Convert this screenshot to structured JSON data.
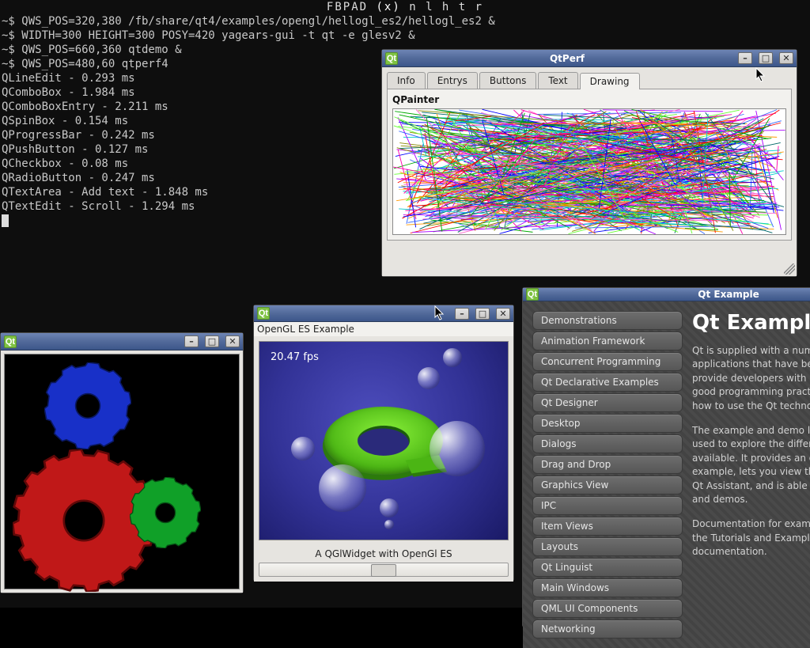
{
  "terminal": {
    "fbpad_prefix": "FBPAD ",
    "fbpad_sel": "(x)",
    "fbpad_rest": " n  l  h  t  r",
    "lines": [
      "~$ QWS_POS=320,380 /fb/share/qt4/examples/opengl/hellogl_es2/hellogl_es2 &",
      "~$ WIDTH=300 HEIGHT=300 POSY=420 yagears-gui -t qt -e glesv2 &",
      "~$ QWS_POS=660,360 qtdemo &",
      "~$ QWS_POS=480,60 qtperf4",
      "QLineEdit - 0.293 ms",
      "QComboBox - 1.984 ms",
      "QComboBoxEntry - 2.211 ms",
      "QSpinBox - 0.154 ms",
      "QProgressBar - 0.242 ms",
      "QPushButton - 0.127 ms",
      "QCheckbox - 0.08 ms",
      "QRadioButton - 0.247 ms",
      "QTextArea - Add text - 1.848 ms",
      "QTextEdit - Scroll - 1.294 ms"
    ]
  },
  "qtperf": {
    "title": "QtPerf",
    "tabs": [
      "Info",
      "Entrys",
      "Buttons",
      "Text",
      "Drawing"
    ],
    "active_tab": 4,
    "label": "QPainter"
  },
  "gears": {
    "title": ""
  },
  "gles": {
    "title": "",
    "header": "OpenGL ES Example",
    "fps": "20.47 fps",
    "caption": "A QGlWidget with OpenGl ES"
  },
  "qtex": {
    "title": "Qt Example",
    "sidebar": [
      "Demonstrations",
      "Animation Framework",
      "Concurrent Programming",
      "Qt Declarative Examples",
      "Qt Designer",
      "Desktop",
      "Dialogs",
      "Drag and Drop",
      "Graphics View",
      "IPC",
      "Item Views",
      "Layouts",
      "Qt Linguist",
      "Main Windows",
      "QML UI Components",
      "Networking"
    ],
    "heading": "Qt Example",
    "para1": "Qt is supplied with a number of example applications that have been written to provide developers with examples of the good programming practices and to show how to use the Qt technologies.",
    "para2": "The example and demo launcher can be used to explore the different categories available. It provides an overview of each example, lets you view the documentation in Qt Assistant, and is able to launch examples and demos.",
    "para3": "Documentation for examples can be found in the Tutorials and Examples section of the Qt documentation."
  },
  "window_buttons": {
    "min": "–",
    "max": "□",
    "close": "✕"
  }
}
